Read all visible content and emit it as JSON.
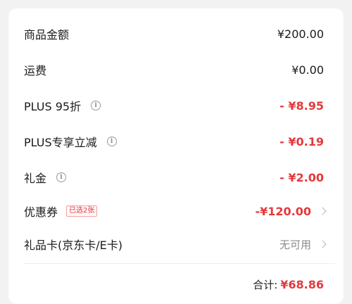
{
  "summary": {
    "rows": [
      {
        "label": "商品金额",
        "value": "¥200.00"
      },
      {
        "label": "运费",
        "value": "¥0.00"
      },
      {
        "label": "PLUS 95折",
        "value": "- ¥8.95"
      },
      {
        "label": "PLUS专享立减",
        "value": "- ¥0.19"
      },
      {
        "label": "礼金",
        "value": "- ¥2.00"
      },
      {
        "label": "优惠券",
        "badge": "已选2张",
        "value": "-¥120.00"
      },
      {
        "label": "礼品卡(京东卡/E卡)",
        "value": "无可用"
      }
    ],
    "info_glyph": "i",
    "total_label": "合计:",
    "total_value": "¥68.86"
  },
  "colors": {
    "accent": "#e4393c",
    "muted": "#8c8c8c"
  }
}
